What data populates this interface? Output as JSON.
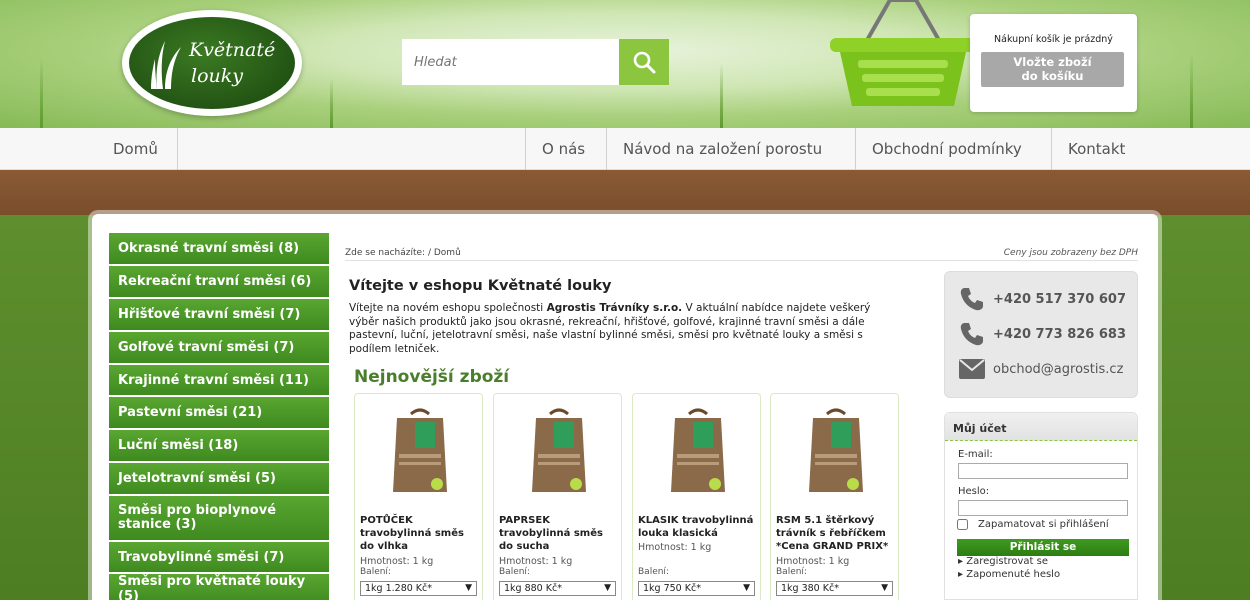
{
  "header": {
    "logo_line1": "Květnaté",
    "logo_line2": "louky",
    "search_placeholder": "Hledat",
    "cart_status": "Nákupní košík je prázdný",
    "cart_button_line1": "Vložte zboží",
    "cart_button_line2": "do košíku"
  },
  "nav": {
    "home": "Domů",
    "about": "O nás",
    "guide": "Návod na založení porostu",
    "terms": "Obchodní podmínky",
    "contact": "Kontakt"
  },
  "sidebar": {
    "categories": [
      "Okrasné travní směsi (8)",
      "Rekreační travní směsi (6)",
      "Hřišťové travní směsi (7)",
      "Golfové travní směsi (7)",
      "Krajinné travní směsi (11)",
      "Pastevní směsi (21)",
      "Luční směsi (18)",
      "Jetelotravní směsi (5)",
      "Směsi pro bioplynové stanice (3)",
      "Travobylinné směsi (7)",
      "Směsi pro květnaté louky (5)"
    ]
  },
  "main": {
    "breadcrumb_prefix": "Zde se nacházíte:",
    "breadcrumb_sep": "/",
    "breadcrumb_current": "Domů",
    "prices_note": "Ceny jsou zobrazeny bez DPH",
    "welcome_title": "Vítejte v eshopu Květnaté louky",
    "intro_before": "Vítejte na novém eshopu společnosti ",
    "intro_company": "Agrostis Trávníky s.r.o.",
    "intro_after": " V aktuální nabídce najdete veškerý výběr našich produktů jako jsou okrasné, rekreační, hřišťové, golfové, krajinné travní směsi a dále pastevní, luční, jetelotravní směsi, naše vlastní bylinné směsi, směsi pro květnaté louky a směsi s podílem letniček.",
    "newest_title": "Nejnovější zboží",
    "products": [
      {
        "name": "POTŮČEK travobylinná směs do vlhka",
        "weight": "Hmotnost: 1 kg",
        "pack_label": "Balení:",
        "option": "1kg 1.280 Kč*"
      },
      {
        "name": "PAPRSEK travobylinná směs do sucha",
        "weight": "Hmotnost: 1 kg",
        "pack_label": "Balení:",
        "option": "1kg 880 Kč*"
      },
      {
        "name": "KLASIK travobylinná louka klasická",
        "weight": "Hmotnost: 1 kg",
        "pack_label": "Balení:",
        "option": "1kg 750 Kč*"
      },
      {
        "name": "RSM 5.1 štěrkový trávník s řebříčkem *Cena GRAND PRIX*",
        "weight": "Hmotnost: 1 kg",
        "pack_label": "Balení:",
        "option": "1kg 380 Kč*"
      }
    ]
  },
  "contact": {
    "phone1": "+420 517 370 607",
    "phone2": "+420 773 826 683",
    "email": "obchod@agrostis.cz"
  },
  "account": {
    "title": "Můj účet",
    "email_label": "E-mail:",
    "password_label": "Heslo:",
    "remember_label": "Zapamatovat si přihlášení",
    "login_button": "Přihlásit se",
    "register_link": "Zaregistrovat se",
    "forgot_link": "Zapomenuté heslo"
  },
  "colors": {
    "accent_green": "#8cc63f",
    "sidebar_green": "#4b9626",
    "heading_green": "#4a7e2b"
  }
}
